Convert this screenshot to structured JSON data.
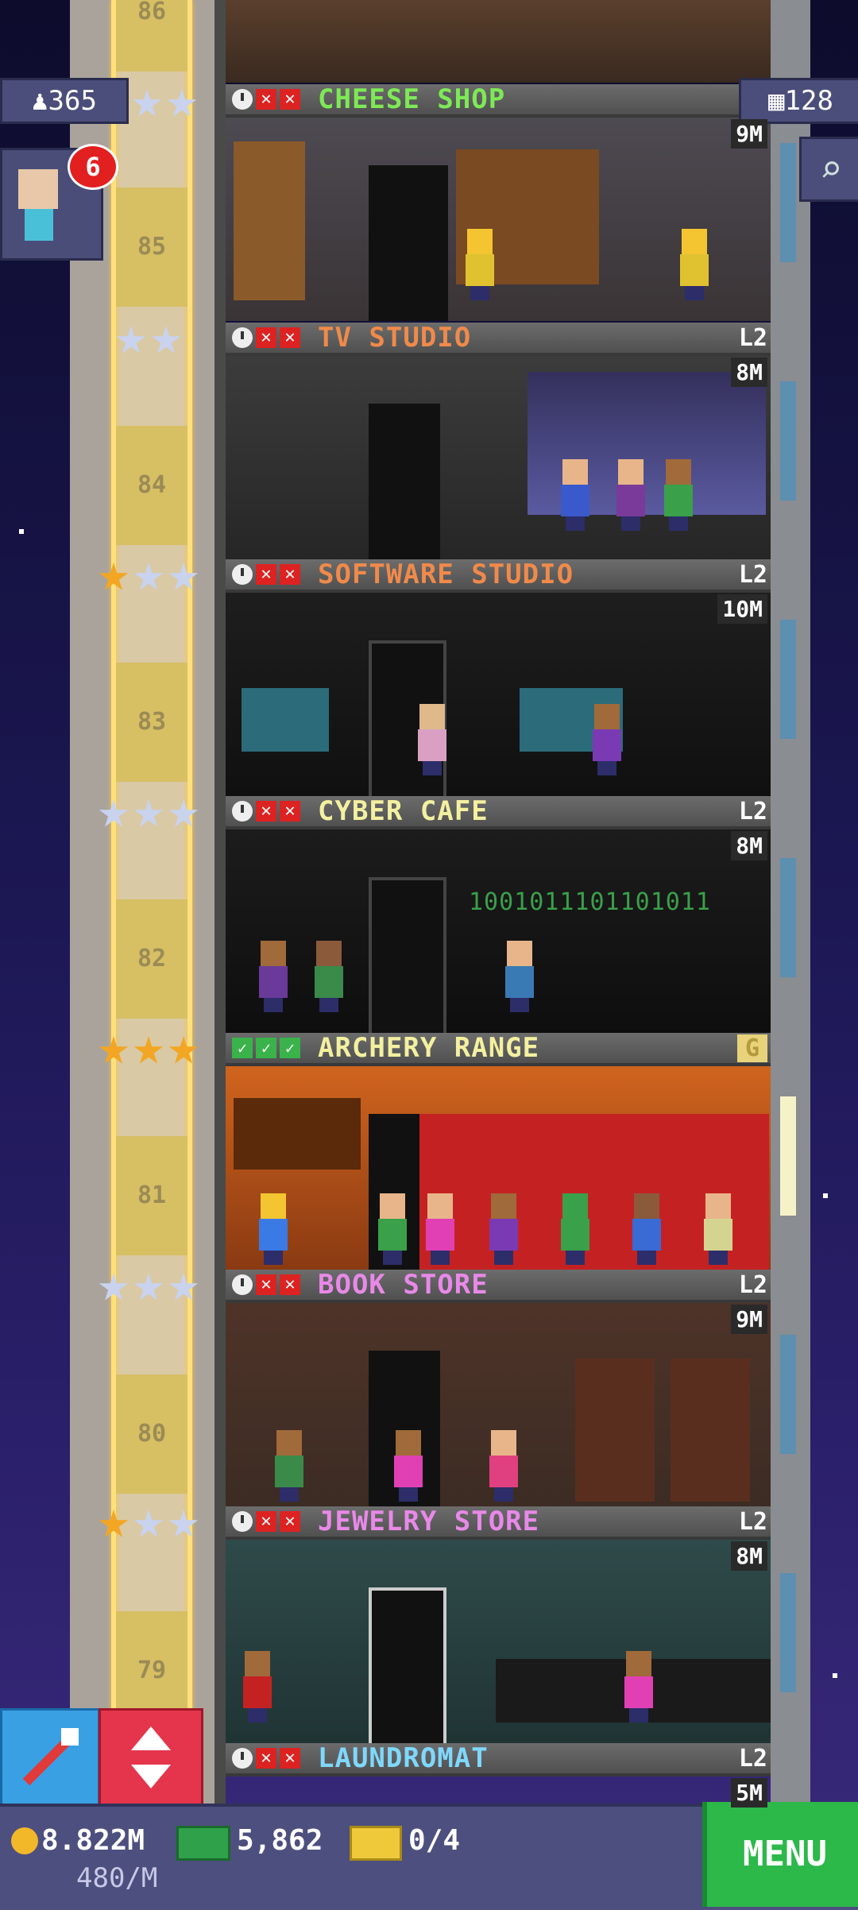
{
  "hud": {
    "population": "365",
    "floors_count": "128",
    "vip_waiting": "6"
  },
  "floors": [
    {
      "number": "86",
      "name": "",
      "level": "",
      "price": ""
    },
    {
      "number": "85",
      "name": "CHEESE SHOP",
      "level": "",
      "price": "9M",
      "color": "#7dea55",
      "stars": [
        "silver",
        "silver"
      ]
    },
    {
      "number": "84",
      "name": "TV STUDIO",
      "level": "L2",
      "price": "8M",
      "color": "#f08a4a",
      "stars": [
        "silver",
        "silver"
      ]
    },
    {
      "number": "83",
      "name": "SOFTWARE STUDIO",
      "level": "L2",
      "price": "10M",
      "color": "#f08a4a",
      "stars": [
        "gold",
        "silver",
        "silver"
      ]
    },
    {
      "number": "82",
      "name": "CYBER CAFE",
      "level": "L2",
      "price": "8M",
      "color": "#f3f0a0",
      "stars": [
        "silver",
        "silver",
        "silver"
      ]
    },
    {
      "number": "81",
      "name": "ARCHERY RANGE",
      "level": "G",
      "price": "",
      "color": "#f3f0a0",
      "stars": [
        "gold",
        "gold",
        "gold"
      ]
    },
    {
      "number": "80",
      "name": "BOOK STORE",
      "level": "L2",
      "price": "9M",
      "color": "#e889e8",
      "stars": [
        "silver",
        "silver",
        "silver"
      ]
    },
    {
      "number": "79",
      "name": "JEWELRY STORE",
      "level": "L2",
      "price": "8M",
      "color": "#e889e8",
      "stars": [
        "gold",
        "silver",
        "silver"
      ]
    },
    {
      "number": "",
      "name": "LAUNDROMAT",
      "level": "L2",
      "price": "5M",
      "color": "#7fd8ff",
      "stars": []
    }
  ],
  "cyber_cafe_sign": "1001011101101011",
  "bottom": {
    "coins": "8.822M",
    "rate": "480/M",
    "bux": "5,862",
    "tickets": "0/4",
    "menu": "MENU"
  },
  "colors": {
    "sky": "#1b1752",
    "menu_green": "#2db84a",
    "build_blue": "#3aa0e4",
    "elevator_red": "#e4354d"
  }
}
